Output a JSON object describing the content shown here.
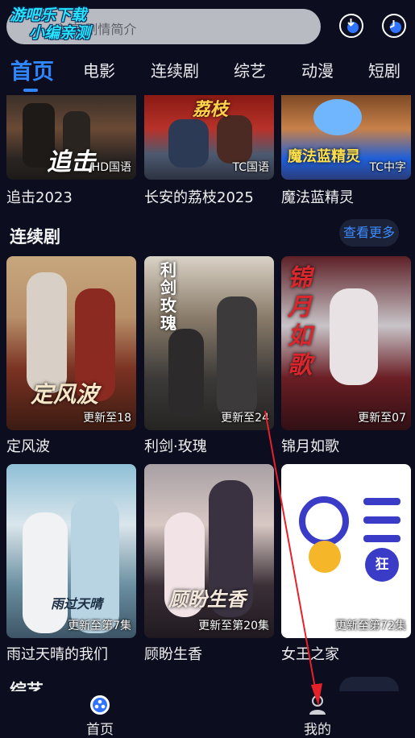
{
  "watermark": {
    "line1": "游吧乐下载",
    "line2": "小编亲测"
  },
  "search": {
    "placeholder": "主演/剧情简介"
  },
  "header_icons": [
    "download-icon",
    "history-icon"
  ],
  "tabs": [
    {
      "label": "首页",
      "active": true
    },
    {
      "label": "电影"
    },
    {
      "label": "连续剧"
    },
    {
      "label": "综艺"
    },
    {
      "label": "动漫"
    },
    {
      "label": "短剧"
    }
  ],
  "movies": [
    {
      "title": "追击2023",
      "badge": "HD国语",
      "art_text": "追击"
    },
    {
      "title": "长安的荔枝2025",
      "badge": "TC国语",
      "art_text": "荔枝"
    },
    {
      "title": "魔法蓝精灵",
      "badge": "TC中字",
      "art_text": "魔法蓝精灵"
    }
  ],
  "series_section": {
    "title": "连续剧",
    "more_label": "查看更多"
  },
  "series": [
    {
      "title": "定风波",
      "badge": "更新至18",
      "art_text": "定风波"
    },
    {
      "title": "利剑·玫瑰",
      "badge": "更新至24",
      "art_text": "利剑玫瑰"
    },
    {
      "title": "锦月如歌",
      "badge": "更新至07",
      "art_text": "锦月如歌"
    },
    {
      "title": "雨过天晴的我们",
      "badge": "更新至第7集",
      "art_text": "雨过天晴"
    },
    {
      "title": "顾盼生香",
      "badge": "更新至第20集",
      "art_text": "顾盼生香"
    },
    {
      "title": "女王之家",
      "badge": "更新至第72集",
      "art_text": "狂"
    }
  ],
  "next_section": {
    "title": "综艺"
  },
  "bottom_nav": [
    {
      "label": "首页",
      "icon": "home-icon"
    },
    {
      "label": "我的",
      "icon": "profile-icon"
    }
  ],
  "colors": {
    "accent": "#2f86ff",
    "background": "#0c0e1f",
    "annotation": "#e8202a"
  }
}
